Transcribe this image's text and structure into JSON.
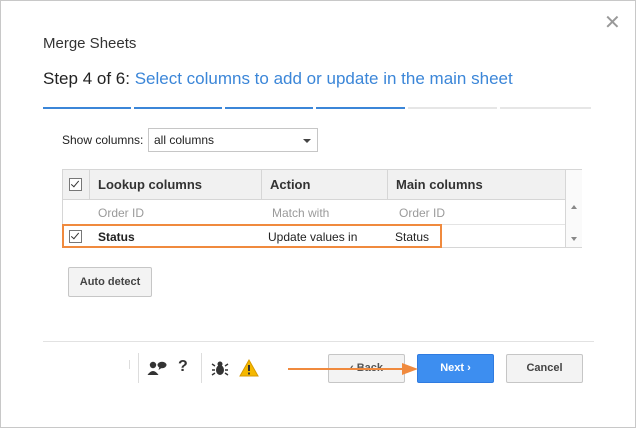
{
  "dialog": {
    "title": "Merge Sheets",
    "step_prefix": "Step 4 of 6:",
    "step_text": "Select columns to add or update in the main sheet",
    "progress": {
      "current_step": 4,
      "total_steps": 6
    },
    "close_icon": "close-icon"
  },
  "show_columns": {
    "label": "Show columns:",
    "selected": "all columns"
  },
  "table": {
    "headers": {
      "lookup": "Lookup columns",
      "action": "Action",
      "main": "Main columns"
    },
    "rows": [
      {
        "checked": false,
        "lookup": "Order ID",
        "action": "Match with",
        "main": "Order ID",
        "state": "disabled"
      },
      {
        "checked": true,
        "lookup": "Status",
        "action": "Update values in",
        "main": "Status",
        "state": "selected"
      }
    ]
  },
  "buttons": {
    "auto_detect": "Auto detect",
    "back": "Back",
    "next": "Next",
    "cancel": "Cancel"
  },
  "footer_icons": [
    "contact-icon",
    "help-icon",
    "bug-icon",
    "warning-icon"
  ],
  "colors": {
    "accent": "#3b86d8",
    "next_button": "#3d8ef0",
    "highlight": "#f08a3e"
  }
}
